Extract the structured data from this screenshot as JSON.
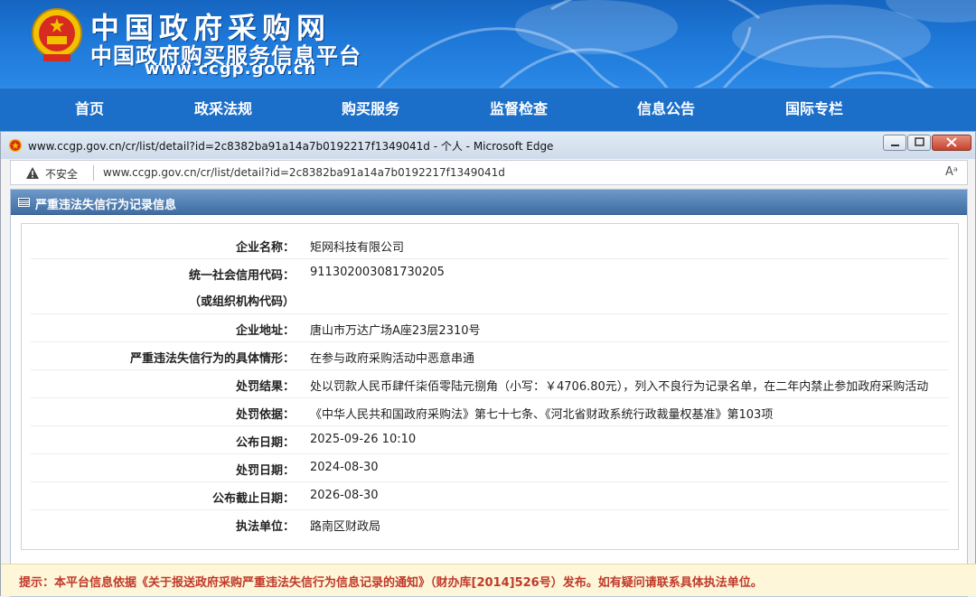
{
  "site": {
    "title": "中国政府采购网",
    "subtitle": "中国政府购买服务信息平台",
    "url": "www.ccgp.gov.cn"
  },
  "nav": {
    "items": [
      {
        "label": "首页"
      },
      {
        "label": "政采法规"
      },
      {
        "label": "购买服务"
      },
      {
        "label": "监督检查"
      },
      {
        "label": "信息公告"
      },
      {
        "label": "国际专栏"
      }
    ]
  },
  "browser": {
    "window_title": "www.ccgp.gov.cn/cr/list/detail?id=2c8382ba91a14a7b0192217f1349041d - 个人 - Microsoft Edge",
    "security_label": "不安全",
    "address": "www.ccgp.gov.cn/cr/list/detail?id=2c8382ba91a14a7b0192217f1349041d",
    "read_aloud_icon": "Aᵃ"
  },
  "panel": {
    "title": "严重违法失信行为记录信息"
  },
  "record": {
    "rows": [
      {
        "label": "企业名称：",
        "value": "矩网科技有限公司"
      },
      {
        "label": "统一社会信用代码：",
        "label2": "（或组织机构代码）",
        "value": "911302003081730205"
      },
      {
        "label": "企业地址：",
        "value": "唐山市万达广场A座23层2310号"
      },
      {
        "label": "严重违法失信行为的具体情形：",
        "value": "在参与政府采购活动中恶意串通"
      },
      {
        "label": "处罚结果：",
        "value": "处以罚款人民币肆仟柒佰零陆元捌角（小写：￥4706.80元），列入不良行为记录名单，在二年内禁止参加政府采购活动"
      },
      {
        "label": "处罚依据：",
        "value": "《中华人民共和国政府采购法》第七十七条、《河北省财政系统行政裁量权基准》第103项"
      },
      {
        "label": "公布日期：",
        "value": "2025-09-26 10:10"
      },
      {
        "label": "处罚日期：",
        "value": "2024-08-30"
      },
      {
        "label": "公布截止日期：",
        "value": "2026-08-30"
      },
      {
        "label": "执法单位：",
        "value": "路南区财政局"
      }
    ]
  },
  "notice": {
    "text": "提示：本平台信息依据《关于报送政府采购严重违法失信行为信息记录的通知》（财办库[2014]526号）发布。如有疑问请联系具体执法单位。"
  }
}
